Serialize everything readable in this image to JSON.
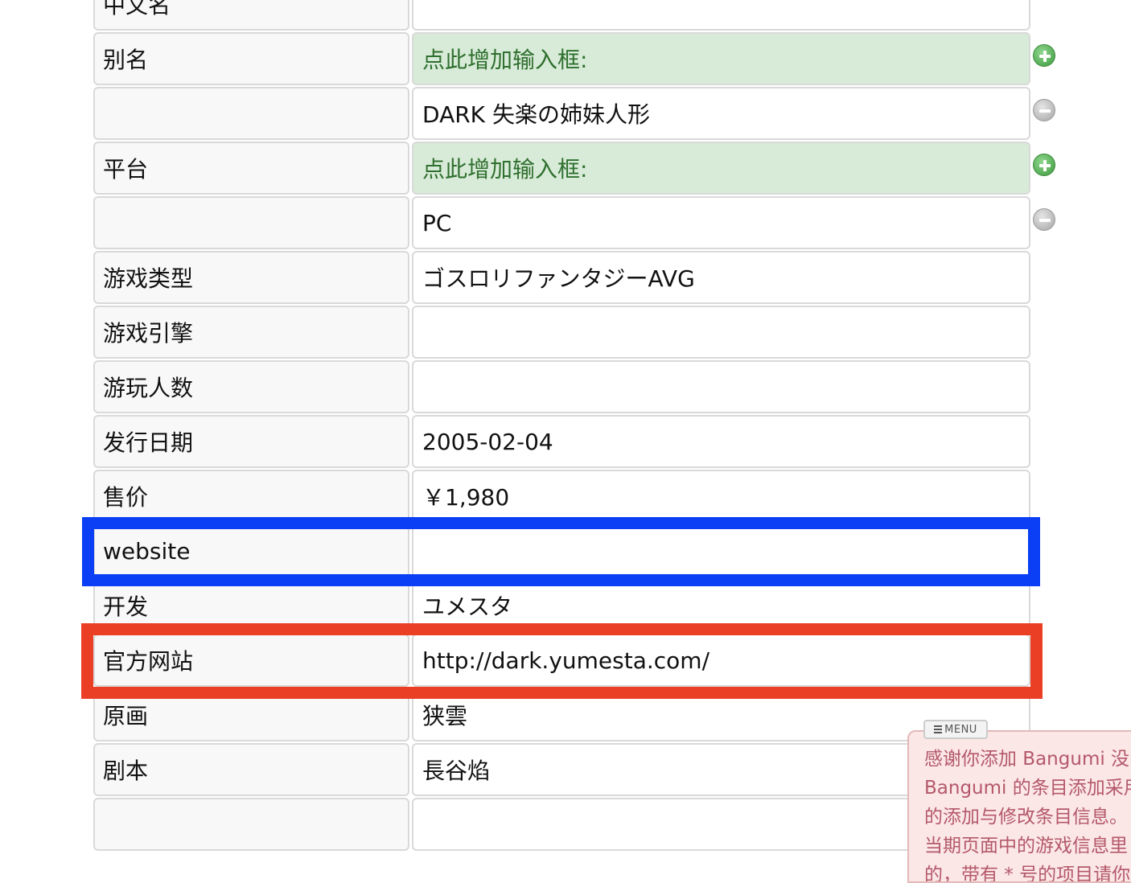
{
  "form": {
    "rows": [
      {
        "label": "中文名",
        "value": ""
      },
      {
        "label": "别名",
        "value": "点此增加输入框:"
      },
      {
        "label": "",
        "value": "DARK 失楽の姉妹人形"
      },
      {
        "label": "平台",
        "value": "点此增加输入框:"
      },
      {
        "label": "",
        "value": "PC"
      },
      {
        "label": "游戏类型",
        "value": "ゴスロリファンタジーAVG"
      },
      {
        "label": "游戏引擎",
        "value": ""
      },
      {
        "label": "游玩人数",
        "value": ""
      },
      {
        "label": "发行日期",
        "value": "2005-02-04"
      },
      {
        "label": "售价",
        "value": "￥1,980"
      },
      {
        "label": "website",
        "value": ""
      },
      {
        "label": "开发",
        "value": "ユメスタ"
      },
      {
        "label": "官方网站",
        "value": "http://dark.yumesta.com/"
      },
      {
        "label": "原画",
        "value": "狭雲"
      },
      {
        "label": "剧本",
        "value": "長谷焰"
      },
      {
        "label": "",
        "value": ""
      }
    ]
  },
  "icons": {
    "add": "plus-circle-icon",
    "remove": "minus-circle-icon"
  },
  "menu_popup": {
    "tab_label": "MENU",
    "lines": [
      "感谢你添加 Bangumi 没",
      "Bangumi 的条目添加采用",
      "的添加与修改条目信息。",
      "当期页面中的游戏信息里",
      "的，带有 * 号的项目请你"
    ]
  },
  "colors": {
    "highlight_blue": "#0a3ff5",
    "highlight_red": "#ea3f24",
    "adder_bg": "#d8ebd8",
    "adder_text": "#2f6f2f",
    "popup_bg": "#fbe7e6",
    "popup_text": "#b4586a"
  }
}
